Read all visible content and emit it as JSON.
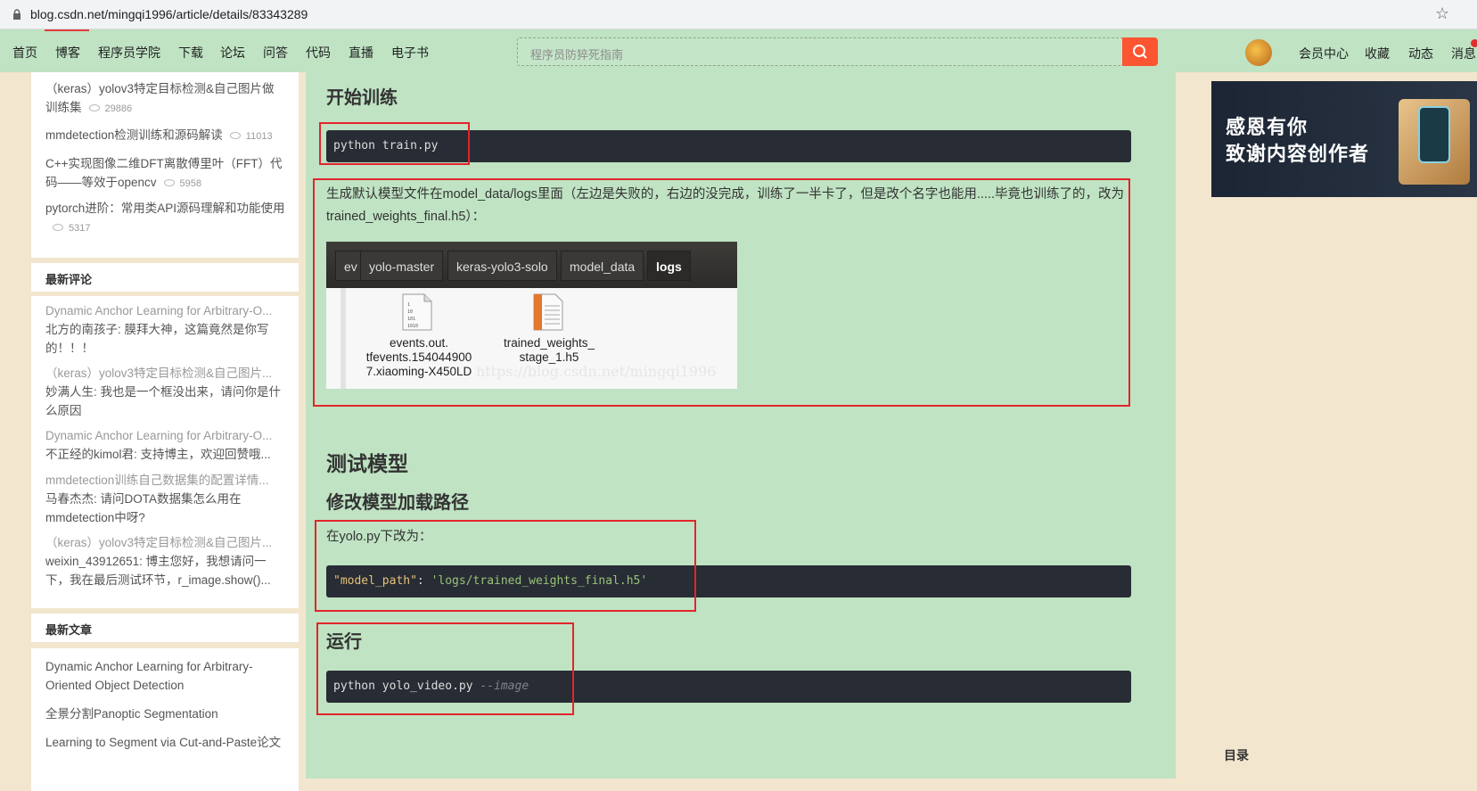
{
  "browser": {
    "url": "blog.csdn.net/mingqi1996/article/details/83343289"
  },
  "nav": {
    "items": [
      "首页",
      "博客",
      "程序员学院",
      "下载",
      "论坛",
      "问答",
      "代码",
      "直播",
      "电子书"
    ],
    "search_placeholder": "程序员防猝死指南",
    "right_items": [
      "会员中心",
      "收藏",
      "动态",
      "消息"
    ]
  },
  "sidebar": {
    "hot_articles": [
      {
        "title": "（keras）yolov3特定目标检测&自己图片做训练集",
        "views": "29886"
      },
      {
        "title": "mmdetection检测训练和源码解读",
        "views": "11013"
      },
      {
        "title": "C++实现图像二维DFT离散傅里叶（FFT）代码——等效于opencv",
        "views": "5958"
      },
      {
        "title": "pytorch进阶：常用类API源码理解和功能使用",
        "views": "5317"
      }
    ],
    "comments_title": "最新评论",
    "comments": [
      {
        "article": "Dynamic Anchor Learning for Arbitrary-O...",
        "body": "北方的南孩子: 膜拜大神，这篇竟然是你写的！！！"
      },
      {
        "article": "（keras）yolov3特定目标检测&自己图片...",
        "body": "妙满人生: 我也是一个框没出来，请问你是什么原因"
      },
      {
        "article": "Dynamic Anchor Learning for Arbitrary-O...",
        "body": "不正经的kimol君: 支持博主，欢迎回赞哦..."
      },
      {
        "article": "mmdetection训练自己数据集的配置详情...",
        "body": "马春杰杰: 请问DOTA数据集怎么用在mmdetection中呀?"
      },
      {
        "article": "（keras）yolov3特定目标检测&自己图片...",
        "body": "weixin_43912651: 博主您好，我想请问一下，我在最后测试环节，r_image.show()..."
      }
    ],
    "recent_title": "最新文章",
    "recent": [
      "Dynamic Anchor Learning for Arbitrary-Oriented Object Detection",
      "全景分割Panoptic Segmentation",
      "Learning to Segment via Cut-and-Paste论文"
    ]
  },
  "article": {
    "h_train": "开始训练",
    "code_train": "python train.py",
    "para_model": "生成默认模型文件在model_data/logs里面（左边是失败的，右边的没完成，训练了一半卡了，但是改个名字也能用.....毕竟也训练了的，改为trained_weights_final.h5）：",
    "screenshot": {
      "crumbs": [
        "ev",
        "yolo-master",
        "keras-yolo3-solo",
        "model_data",
        "logs"
      ],
      "file1": [
        "events.out.",
        "tfevents.154044900",
        "7.xiaoming-X450LD"
      ],
      "file2": [
        "trained_weights_",
        "stage_1.h5"
      ],
      "watermark": "https://blog.csdn.net/mingqi1996"
    },
    "h_test": "测试模型",
    "h_modify": "修改模型加载路径",
    "para_yolo": "在yolo.py下改为：",
    "code_path_key": "\"model_path\"",
    "code_path_colon": ": ",
    "code_path_val": "'logs/trained_weights_final.h5'",
    "h_run": "运行",
    "code_run": "python yolo_video.py ",
    "code_run_arg": "--image"
  },
  "right": {
    "banner_line1": "感恩有你",
    "banner_line2": "致谢内容创作者",
    "toc": "目录"
  },
  "colors": {
    "nav_bg": "#bfe3c3",
    "accent": "#fc5531",
    "highlight_box": "#e3242b"
  }
}
